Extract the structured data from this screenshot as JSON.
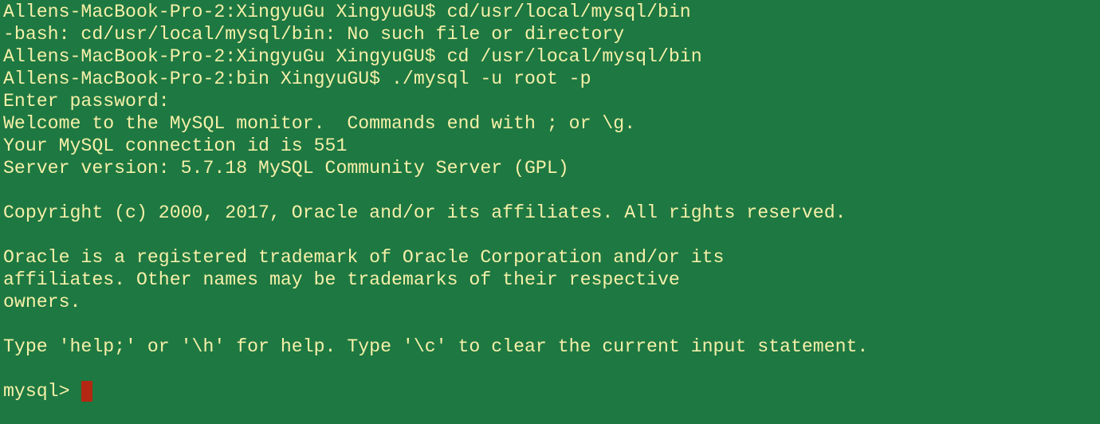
{
  "terminal": {
    "background_color": "#1e7842",
    "text_color": "#f5f0a8",
    "cursor_color": "#b42712",
    "lines": [
      "Allens-MacBook-Pro-2:XingyuGu XingyuGU$ cd/usr/local/mysql/bin",
      "-bash: cd/usr/local/mysql/bin: No such file or directory",
      "Allens-MacBook-Pro-2:XingyuGu XingyuGU$ cd /usr/local/mysql/bin",
      "Allens-MacBook-Pro-2:bin XingyuGU$ ./mysql -u root -p",
      "Enter password:",
      "Welcome to the MySQL monitor.  Commands end with ; or \\g.",
      "Your MySQL connection id is 551",
      "Server version: 5.7.18 MySQL Community Server (GPL)",
      "",
      "Copyright (c) 2000, 2017, Oracle and/or its affiliates. All rights reserved.",
      "",
      "Oracle is a registered trademark of Oracle Corporation and/or its",
      "affiliates. Other names may be trademarks of their respective",
      "owners.",
      "",
      "Type 'help;' or '\\h' for help. Type '\\c' to clear the current input statement.",
      ""
    ],
    "prompt": "mysql>",
    "input_value": ""
  }
}
